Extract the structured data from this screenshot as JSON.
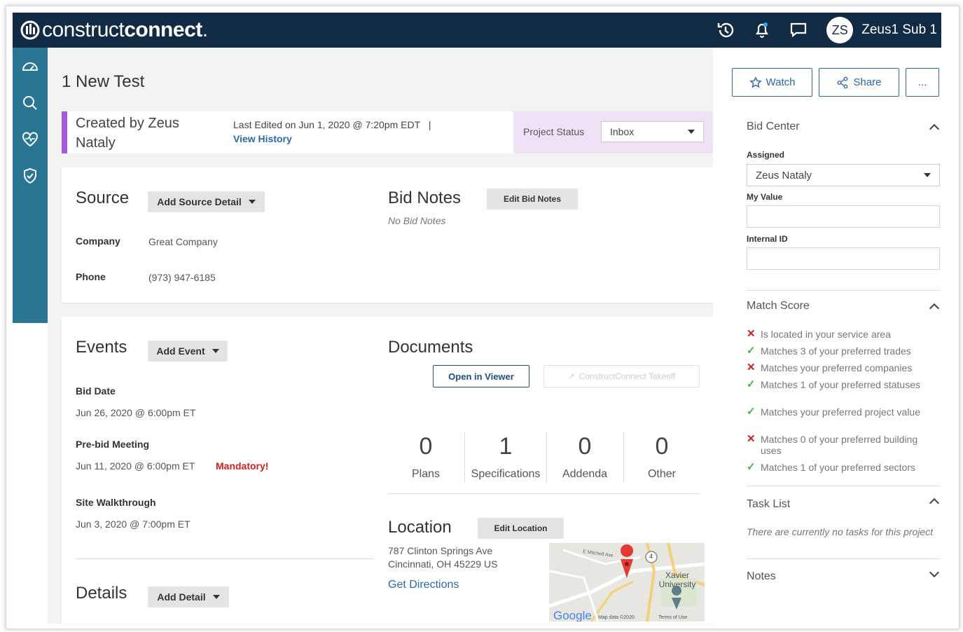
{
  "brand": {
    "name_thin": "construct",
    "name_bold": "connect",
    "tld": "."
  },
  "topnav": {
    "icons": [
      "history-icon",
      "bell-icon",
      "chat-icon"
    ],
    "user": {
      "initials": "ZS",
      "name": "Zeus1 Sub 1"
    }
  },
  "sidebar": {
    "icons": [
      "dashboard-icon",
      "search-icon",
      "heart-icon",
      "shield-check-icon"
    ]
  },
  "project": {
    "title": "1 New Test",
    "created_by": "Created by Zeus Nataly",
    "last_edited": "Last Edited on Jun 1, 2020 @ 7:20pm EDT",
    "edit_separator": "|",
    "view_history": "View History",
    "status_label": "Project Status",
    "status_value": "Inbox"
  },
  "source": {
    "title": "Source",
    "add_button": "Add Source Detail",
    "company_label": "Company",
    "company_value": "Great Company",
    "phone_label": "Phone",
    "phone_value": "(973) 947-6185"
  },
  "bid_notes": {
    "title": "Bid Notes",
    "edit_button": "Edit Bid Notes",
    "empty": "No Bid Notes"
  },
  "events": {
    "title": "Events",
    "add_button": "Add Event",
    "items": [
      {
        "label": "Bid Date",
        "value": "Jun 26, 2020 @ 6:00pm ET",
        "flag": ""
      },
      {
        "label": "Pre-bid Meeting",
        "value": "Jun 11, 2020 @ 6:00pm ET",
        "flag": "Mandatory!"
      },
      {
        "label": "Site Walkthrough",
        "value": "Jun 3, 2020 @ 7:00pm ET",
        "flag": ""
      }
    ]
  },
  "details": {
    "title": "Details",
    "add_button": "Add Detail"
  },
  "documents": {
    "title": "Documents",
    "open_viewer": "Open in Viewer",
    "takeoff": "ConstructConnect Takeoff",
    "counts": [
      {
        "value": "0",
        "label": "Plans"
      },
      {
        "value": "1",
        "label": "Specifications"
      },
      {
        "value": "0",
        "label": "Addenda"
      },
      {
        "value": "0",
        "label": "Other"
      }
    ]
  },
  "location": {
    "title": "Location",
    "edit_button": "Edit Location",
    "address1": "787 Clinton Springs Ave",
    "address2": "Cincinnati, OH 45229 US",
    "directions": "Get Directions",
    "map": {
      "street": "E Mitchell Ave",
      "route": "4",
      "poi": "Xavier University",
      "provider": "Google",
      "attribution": "Map data ©2020",
      "terms": "Terms of Use"
    }
  },
  "actions": {
    "watch": "Watch",
    "share": "Share",
    "more": "..."
  },
  "bid_center": {
    "title": "Bid Center",
    "assigned_label": "Assigned",
    "assigned_value": "Zeus Nataly",
    "my_value_label": "My Value",
    "internal_id_label": "Internal ID"
  },
  "match_score": {
    "title": "Match Score",
    "items": [
      {
        "ok": false,
        "text": "Is located in your service area"
      },
      {
        "ok": true,
        "text": "Matches 3 of your preferred trades"
      },
      {
        "ok": false,
        "text": "Matches your preferred companies"
      },
      {
        "ok": true,
        "text": "Matches 1 of your preferred statuses"
      },
      {
        "ok": true,
        "text": "Matches your preferred project value"
      },
      {
        "ok": false,
        "text": "Matches 0 of your preferred building uses"
      },
      {
        "ok": true,
        "text": "Matches 1 of your preferred sectors"
      }
    ]
  },
  "task_list": {
    "title": "Task List",
    "empty": "There are currently no tasks for this project"
  },
  "notes": {
    "title": "Notes"
  },
  "colors": {
    "navy": "#122b45",
    "sidebar": "#2a7494",
    "accent_purple": "#a45bd9",
    "link_blue": "#2b6aa8",
    "mandatory_red": "#d31e1e",
    "check_green": "#4cae4c"
  }
}
